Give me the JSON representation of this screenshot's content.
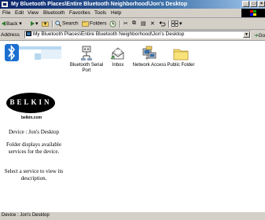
{
  "window": {
    "title": "My Bluetooth Places\\Entire Bluetooth Neighborhood\\Jon's Desktop",
    "minimize": "_",
    "maximize": "□",
    "close": "×"
  },
  "menubar": {
    "items": [
      "File",
      "Edit",
      "View",
      "Bluetooth",
      "Favorites",
      "Tools",
      "Help"
    ]
  },
  "toolbar": {
    "back": "Back",
    "search": "Search",
    "folders": "Folders"
  },
  "address": {
    "label": "Address",
    "value": "My Bluetooth Places\\Entire Bluetooth Neighborhood\\Jon's Desktop",
    "go": "Go"
  },
  "left_pane": {
    "brand": "BELKIN",
    "brand_url": "belkin.com",
    "device_line": "Device : Jon's Desktop",
    "folder_desc": "Folder displays available services for the device.",
    "select_desc": "Select a service to view its description."
  },
  "services": [
    {
      "label": "Bluetooth Serial Port",
      "icon": "serial-port-icon"
    },
    {
      "label": "Inbox",
      "icon": "inbox-icon"
    },
    {
      "label": "Network Access",
      "icon": "network-access-icon"
    },
    {
      "label": "Public Folder",
      "icon": "folder-icon"
    }
  ],
  "status": {
    "text": "Device : Jon's Desktop"
  }
}
